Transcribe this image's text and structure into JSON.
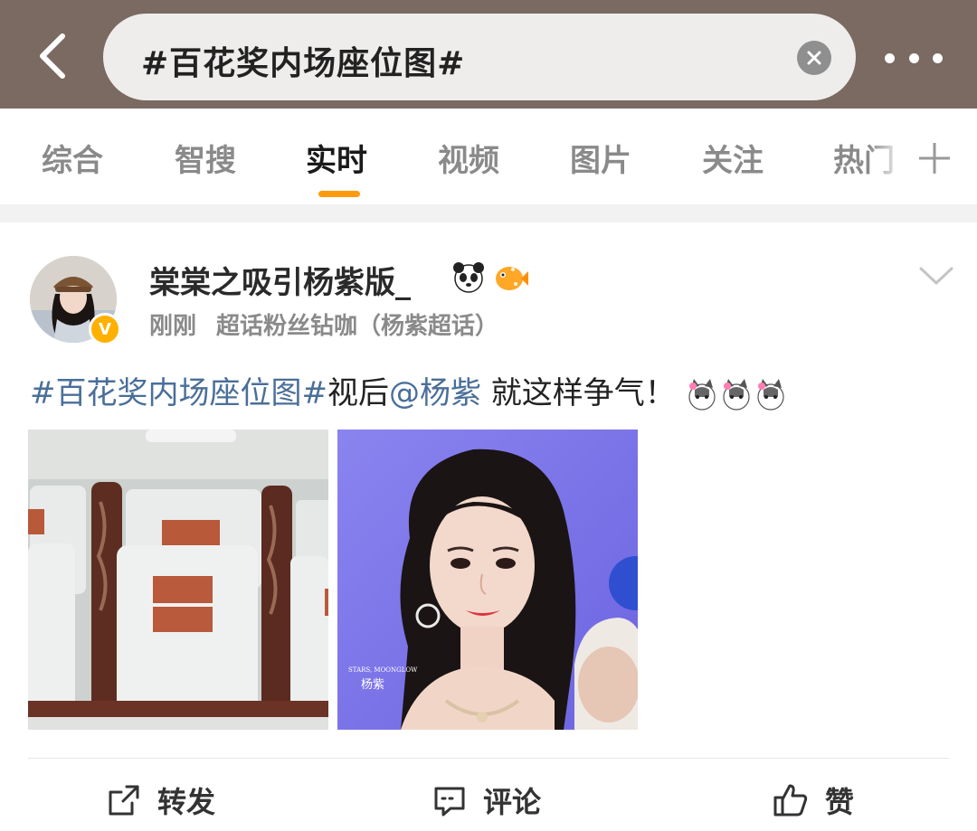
{
  "header": {
    "search_query": "#百花奖内场座位图#",
    "back_icon": "chevron-left-icon",
    "clear_icon": "close-icon",
    "more_icon": "more-dots-icon",
    "bg_color": "#7a6a62"
  },
  "tabs": [
    {
      "label": "综合",
      "active": false
    },
    {
      "label": "智搜",
      "active": false
    },
    {
      "label": "实时",
      "active": true
    },
    {
      "label": "视频",
      "active": false
    },
    {
      "label": "图片",
      "active": false
    },
    {
      "label": "关注",
      "active": false
    },
    {
      "label": "热门",
      "active": false
    }
  ],
  "accent_color": "#ff9a0e",
  "post": {
    "username": "棠棠之吸引杨紫版_",
    "verified_badge": "V",
    "time": "刚刚",
    "source": "超话粉丝钻咖（杨紫超话）",
    "text": {
      "hashtag": "#百花奖内场座位图#",
      "pre_mention": "视后",
      "mention": "@杨紫",
      "post_mention": " 就这样争气！"
    },
    "images": [
      {
        "subject": "theater seats with name tags"
      },
      {
        "subject": "portrait photo",
        "caption_top": "STARS, MOONGLOW",
        "caption_name": "杨紫"
      }
    ],
    "link_color": "#4a6f99"
  },
  "actions": {
    "repost": "转发",
    "comment": "评论",
    "like": "赞"
  }
}
